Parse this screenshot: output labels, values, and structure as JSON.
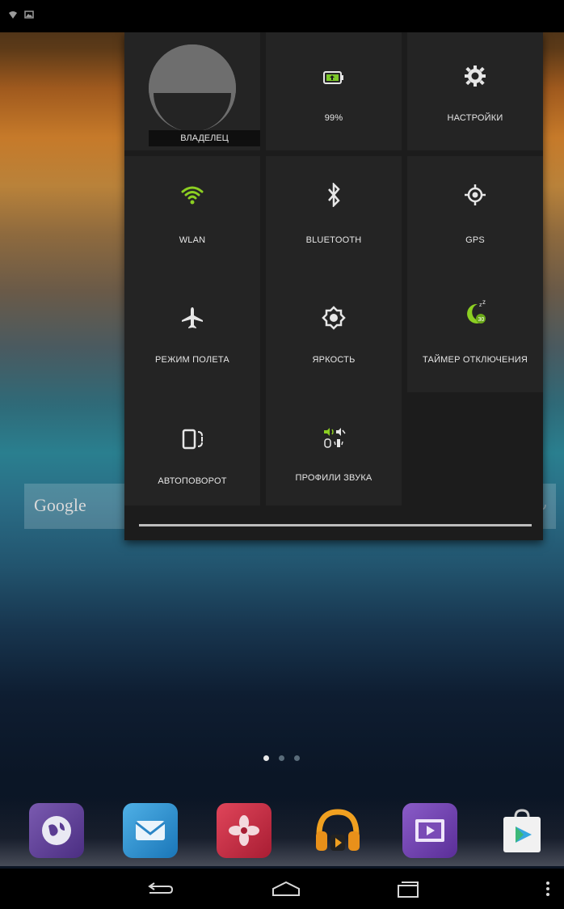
{
  "status_bar": {
    "icons": [
      "wifi-icon",
      "gallery-icon"
    ]
  },
  "quick_settings": {
    "owner_label": "ВЛАДЕЛЕЦ",
    "battery_label": "99%",
    "settings_label": "НАСТРОЙКИ",
    "wlan_label": "WLAN",
    "bluetooth_label": "BLUETOOTH",
    "gps_label": "GPS",
    "airplane_label": "РЕЖИМ ПОЛЕТА",
    "brightness_label": "ЯРКОСТЬ",
    "sleep_timer_label": "ТАЙМЕР ОТКЛЮЧЕНИЯ",
    "autorotate_label": "АВТОПОВОРОТ",
    "sound_profiles_label": "ПРОФИЛИ ЗВУКА"
  },
  "google_search": {
    "label": "Google"
  },
  "home": {
    "page_count": 3,
    "active_page": 1
  },
  "dock": {
    "apps": [
      "browser-icon",
      "email-icon",
      "gallery-app-icon",
      "music-icon",
      "video-icon",
      "play-store-icon"
    ]
  },
  "colors": {
    "wlan_active": "#8ccf22",
    "panel_bg": "#1c1c1c",
    "tile_bg": "#242424"
  }
}
